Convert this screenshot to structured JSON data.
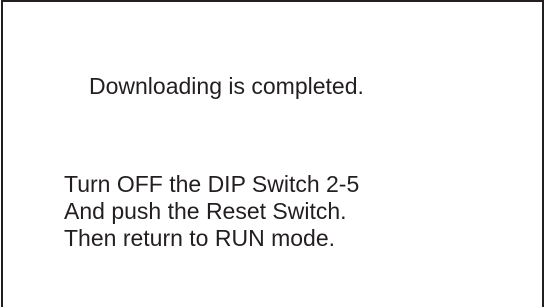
{
  "dialog": {
    "status": "Downloading is completed.",
    "instructions": [
      "Turn OFF the DIP Switch 2-5",
      "And push the Reset Switch.",
      "Then return to RUN mode."
    ]
  },
  "colors": {
    "text": "#231f20",
    "border": "#231f20",
    "background": "#ffffff"
  }
}
